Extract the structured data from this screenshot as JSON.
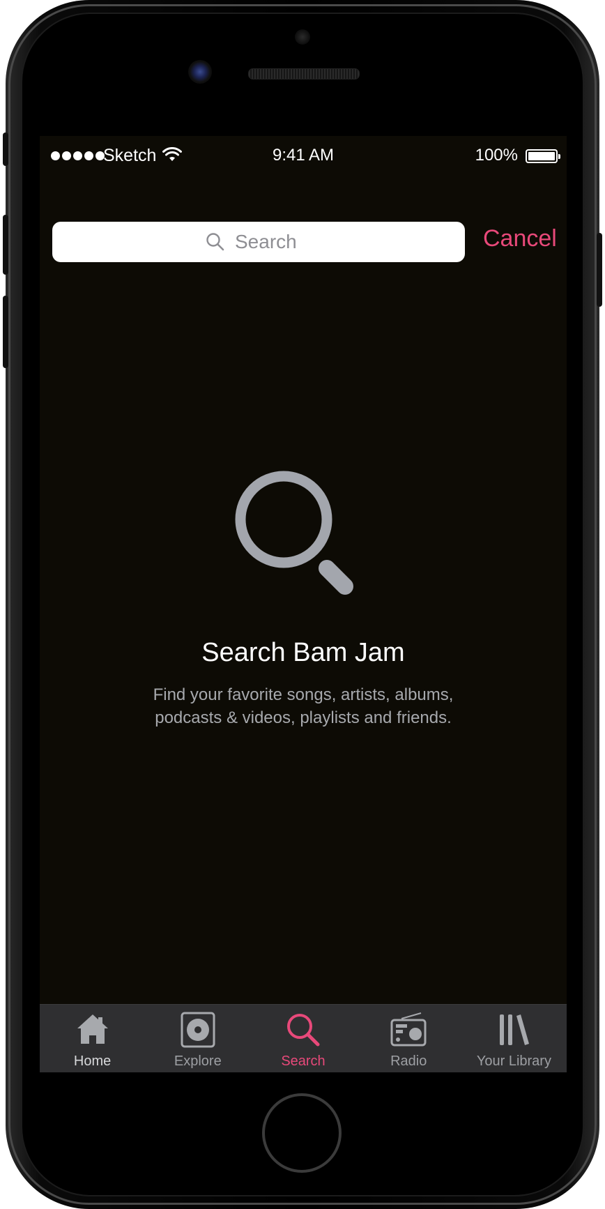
{
  "status_bar": {
    "carrier": "Sketch",
    "time": "9:41 AM",
    "battery": "100%"
  },
  "search": {
    "placeholder": "Search",
    "cancel_label": "Cancel"
  },
  "empty_state": {
    "title": "Search Bam Jam",
    "description": "Find your favorite songs, artists, albums, podcasts & videos, playlists and friends."
  },
  "tab_bar": {
    "items": [
      {
        "label": "Home",
        "icon": "home-icon"
      },
      {
        "label": "Explore",
        "icon": "explore-icon"
      },
      {
        "label": "Search",
        "icon": "search-icon",
        "active": true
      },
      {
        "label": "Radio",
        "icon": "radio-icon"
      },
      {
        "label": "Your Library",
        "icon": "library-icon"
      }
    ]
  },
  "colors": {
    "accent": "#e8497a",
    "background": "#0d0b05",
    "tab_bar": "#2f2f31",
    "icon_gray": "#a7a9ad"
  }
}
